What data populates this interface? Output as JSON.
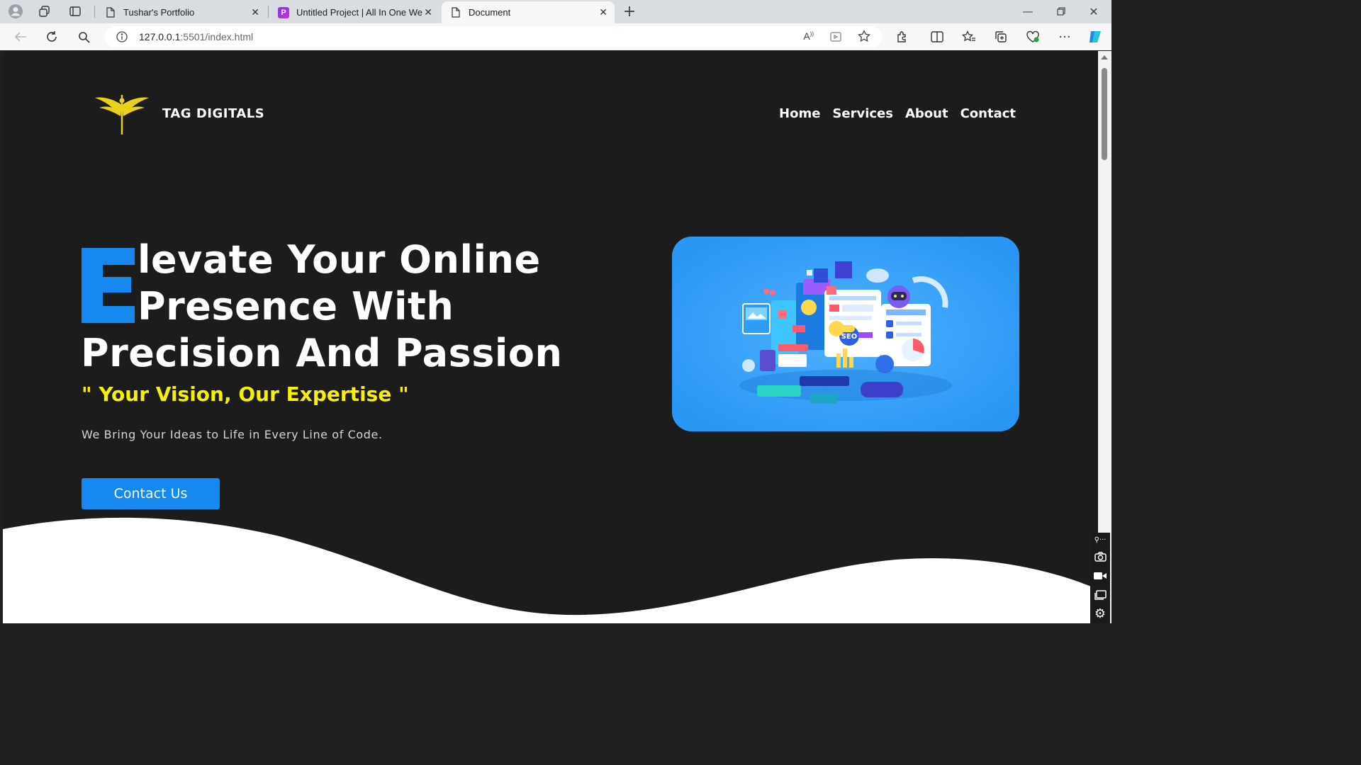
{
  "browser": {
    "tabs": [
      {
        "title": "Tushar's Portfolio"
      },
      {
        "title": "Untitled Project | All In One Web"
      },
      {
        "title": "Document"
      }
    ],
    "url_host": "127.0.0.1",
    "url_path": ":5501/index.html"
  },
  "site": {
    "brand": "TAG DIGITALS",
    "nav": [
      "Home",
      "Services",
      "About",
      "Contact"
    ],
    "hero": {
      "line1": "levate Your Online",
      "line2": "Presence With",
      "line3": "Precision And Passion",
      "tagline": "\" Your Vision, Our Expertise \"",
      "subline": "We Bring Your Ideas to Life in Every Line of Code.",
      "cta": "Contact Us",
      "illustration_badge": "SEO"
    }
  },
  "colors": {
    "page_bg": "#1c1c1c",
    "accent_blue": "#1589ef",
    "accent_yellow": "#f5ef0a",
    "card_blue": "#2a97f5"
  }
}
